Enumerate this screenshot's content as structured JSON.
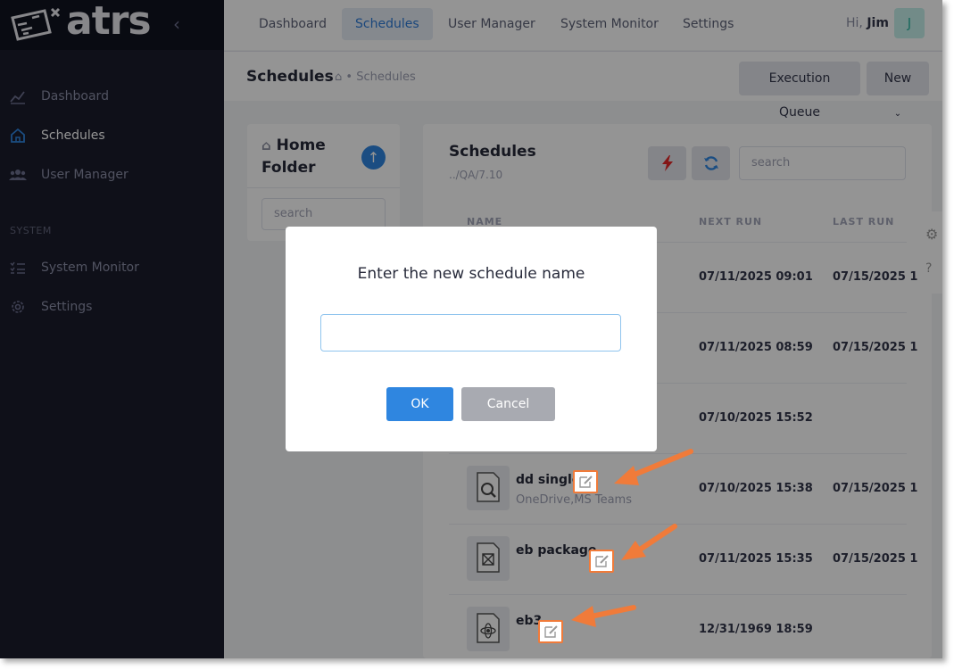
{
  "app": {
    "logo_text": "atrs"
  },
  "sidebar": {
    "items": [
      {
        "label": "Dashboard",
        "icon": "chart-line-icon"
      },
      {
        "label": "Schedules",
        "icon": "home-icon",
        "active": true
      },
      {
        "label": "User Manager",
        "icon": "users-icon"
      }
    ],
    "section_label": "SYSTEM",
    "system_items": [
      {
        "label": "System Monitor",
        "icon": "list-check-icon"
      },
      {
        "label": "Settings",
        "icon": "gear-icon"
      }
    ]
  },
  "topnav": {
    "tabs": [
      {
        "label": "Dashboard"
      },
      {
        "label": "Schedules",
        "active": true
      },
      {
        "label": "User Manager"
      },
      {
        "label": "System Monitor"
      },
      {
        "label": "Settings"
      }
    ],
    "greeting_prefix": "Hi,",
    "user_name": "Jim",
    "avatar_initial": "J"
  },
  "subheader": {
    "title": "Schedules",
    "breadcrumb_sep": "•",
    "breadcrumb": "Schedules",
    "execution_queue_label": "Execution Queue",
    "new_label": "New"
  },
  "folder_panel": {
    "title": "Home Folder",
    "search_placeholder": "search"
  },
  "schedules": {
    "title": "Schedules",
    "path": "../QA/7.10",
    "search_placeholder": "search",
    "columns": {
      "name": "NAME",
      "next_run": "NEXT RUN",
      "last_run": "LAST RUN"
    },
    "rows": [
      {
        "name": "",
        "sub": "",
        "next_run": "07/11/2025 09:01",
        "last_run": "07/15/2025 1"
      },
      {
        "name": "",
        "sub": "",
        "next_run": "07/11/2025 08:59",
        "last_run": "07/15/2025 1"
      },
      {
        "name": "",
        "sub": "",
        "next_run": "07/10/2025 15:52",
        "last_run": ""
      },
      {
        "name": "dd single",
        "sub": "OneDrive,MS Teams",
        "next_run": "07/10/2025 15:38",
        "last_run": "07/15/2025 1"
      },
      {
        "name": "eb package",
        "sub": "",
        "next_run": "07/11/2025 15:35",
        "last_run": "07/15/2025 1"
      },
      {
        "name": "eb3",
        "sub": "",
        "next_run": "12/31/1969 18:59",
        "last_run": ""
      }
    ]
  },
  "dialog": {
    "title": "Enter the new schedule name",
    "input_value": "",
    "ok_label": "OK",
    "cancel_label": "Cancel"
  },
  "colors": {
    "accent": "#2f86e0",
    "annotation": "#f07b3a",
    "sidebar_bg": "#1a1c2b"
  }
}
